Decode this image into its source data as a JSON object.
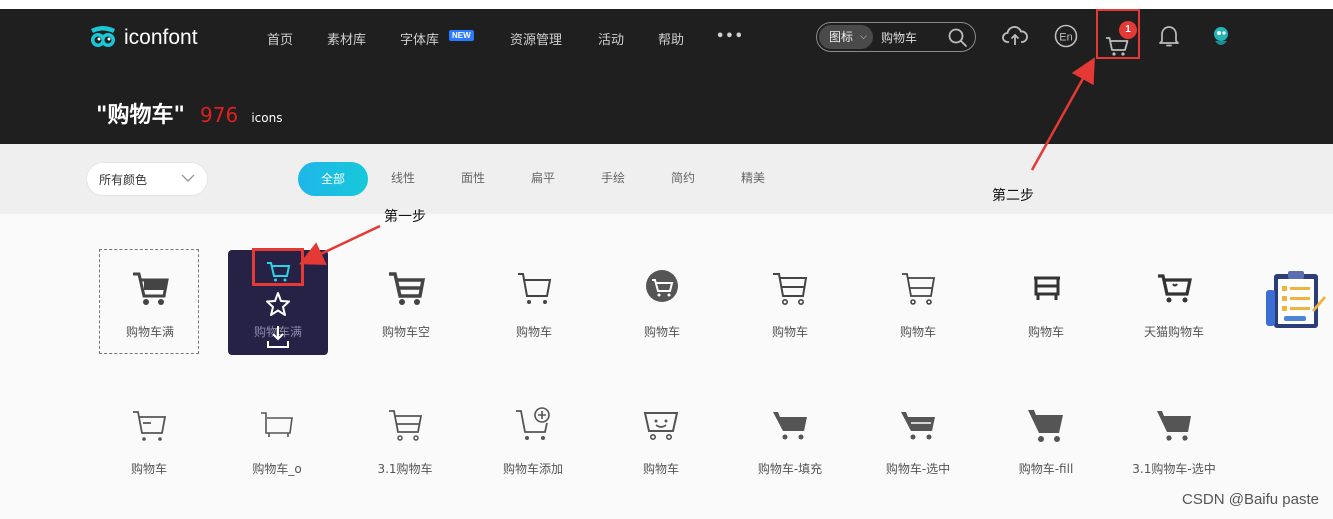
{
  "app": {
    "name": "iconfont"
  },
  "nav": [
    {
      "label": "首页"
    },
    {
      "label": "素材库"
    },
    {
      "label": "字体库",
      "badge": "NEW"
    },
    {
      "label": "资源管理"
    },
    {
      "label": "活动"
    },
    {
      "label": "帮助"
    },
    {
      "label": "•••"
    }
  ],
  "search": {
    "type": "图标",
    "value": "购物车"
  },
  "header_icons": [
    "upload-cloud-icon",
    "english-icon",
    "cart-icon",
    "bell-icon",
    "avatar"
  ],
  "cart": {
    "count": "1"
  },
  "result": {
    "query": "\"购物车\"",
    "count": "976",
    "unit": "icons"
  },
  "filters": {
    "color": "所有颜色",
    "tabs": [
      "全部",
      "线性",
      "面性",
      "扁平",
      "手绘",
      "简约",
      "精美"
    ],
    "active_tab": "全部"
  },
  "icons_row1": [
    "购物车满",
    "购物车满",
    "购物车空",
    "购物车",
    "购物车",
    "购物车",
    "购物车",
    "购物车",
    "天猫购物车"
  ],
  "icons_row2": [
    "购物车",
    "购物车_o",
    "3.1购物车",
    "购物车添加",
    "购物车",
    "购物车-填充",
    "购物车-选中",
    "购物车-fill",
    "3.1购物车-选中"
  ],
  "annotations": {
    "step1": "第一步",
    "step2": "第二步"
  },
  "watermark": "CSDN @Baifu paste",
  "colors": {
    "header_bg": "#1f1f1f",
    "accent": "#1fb6e9",
    "count_red": "#e02020",
    "annotation_red": "#e53935",
    "hover_card": "#252246"
  }
}
